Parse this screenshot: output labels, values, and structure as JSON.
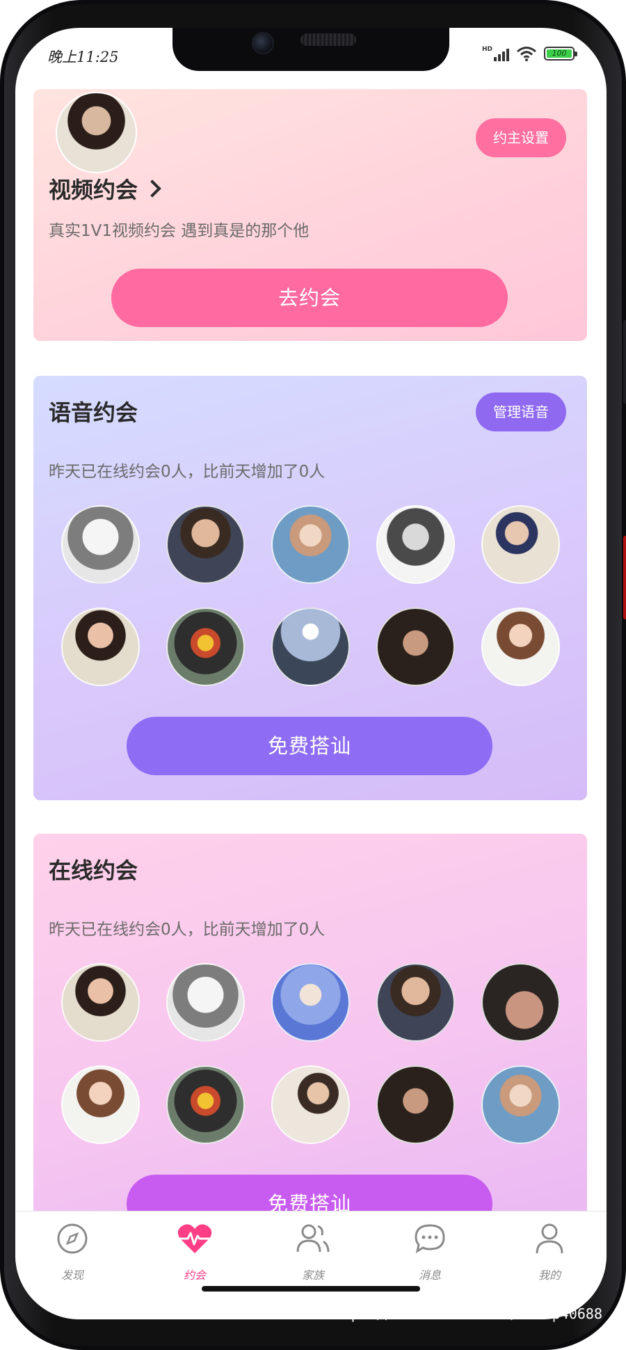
{
  "status": {
    "time": "晚上11:25",
    "signal_label": "HD",
    "battery_level": "100"
  },
  "video_card": {
    "title": "视频约会",
    "subtitle": "真实1V1视频约会 遇到真是的那个他",
    "settings_button": "约主设置",
    "action_button": "去约会",
    "colors": {
      "pill": "#ff6f9f",
      "button": "#ff6aa0"
    }
  },
  "voice_card": {
    "title": "语音约会",
    "manage_button": "管理语音",
    "stats_text": "昨天已在线约会0人，比前天增加了0人",
    "action_button": "免费搭讪",
    "colors": {
      "pill": "#8f6af0",
      "button": "#8e6cf3"
    },
    "avatars": [
      "anime-boy",
      "man-jacket",
      "man-glasses",
      "tattoo-fighter",
      "girl-cap",
      "girl-floral",
      "man-vest",
      "seaside-rock",
      "man-dark",
      "girl-smile"
    ]
  },
  "online_card": {
    "title": "在线约会",
    "stats_text": "昨天已在线约会0人，比前天增加了0人",
    "action_button": "免费搭讪",
    "colors": {
      "button": "#c85cf0"
    },
    "avatars": [
      "girl-floral",
      "anime-boy",
      "girl-sky",
      "man-jacket",
      "woman-shoulder",
      "girl-smile",
      "man-vest",
      "man-dog",
      "man-dark",
      "man-glasses"
    ]
  },
  "tabbar": {
    "items": [
      {
        "label": "发现",
        "icon": "compass-icon",
        "active": false
      },
      {
        "label": "约会",
        "icon": "heart-pulse-icon",
        "active": true
      },
      {
        "label": "家族",
        "icon": "group-icon",
        "active": false
      },
      {
        "label": "消息",
        "icon": "chat-bubble-icon",
        "active": false
      },
      {
        "label": "我的",
        "icon": "person-icon",
        "active": false
      }
    ],
    "colors": {
      "active": "#ff3e86",
      "inactive": "#8a8a8a"
    }
  },
  "watermark": "https://www.huzhan.com/ishop40688"
}
